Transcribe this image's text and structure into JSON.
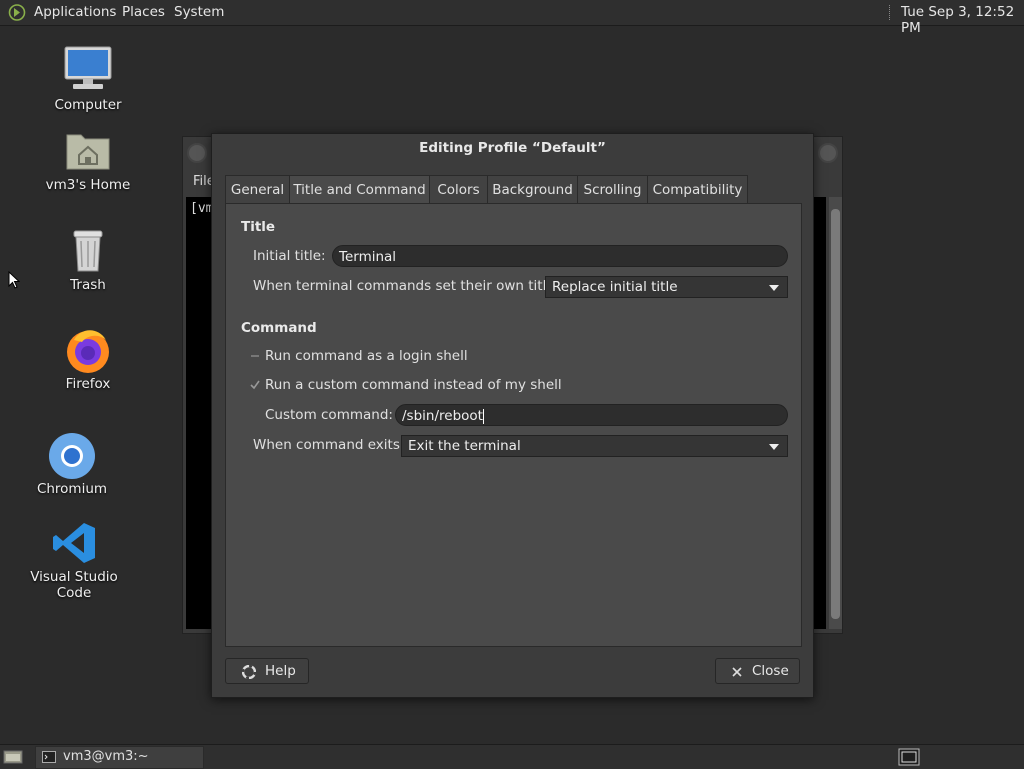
{
  "top_panel": {
    "menus": [
      "Applications",
      "Places",
      "System"
    ],
    "clock": "Tue Sep  3, 12:52 PM"
  },
  "desktop_icons": [
    {
      "label": "Computer",
      "icon": "computer-icon"
    },
    {
      "label": "vm3's Home",
      "icon": "home-folder-icon"
    },
    {
      "label": "Trash",
      "icon": "trash-icon"
    },
    {
      "label": "Firefox",
      "icon": "firefox-icon"
    },
    {
      "label": "Chromium",
      "icon": "chromium-icon"
    },
    {
      "label": "Visual Studio Code",
      "icon": "vscode-icon"
    }
  ],
  "terminal_window": {
    "menu_partial": "File",
    "prompt_partial": "[vm"
  },
  "dialog": {
    "title": "Editing Profile “Default”",
    "tabs": [
      "General",
      "Title and Command",
      "Colors",
      "Background",
      "Scrolling",
      "Compatibility"
    ],
    "active_tab": "Title and Command",
    "title_section": {
      "heading": "Title",
      "initial_title_label": "Initial title:",
      "initial_title_value": "Terminal",
      "own_titles_label": "When terminal commands set their own titles:",
      "own_titles_value": "Replace initial title"
    },
    "command_section": {
      "heading": "Command",
      "login_shell_label": "Run command as a login shell",
      "login_shell_checked": false,
      "custom_command_toggle_label": "Run a custom command instead of my shell",
      "custom_command_toggle_checked": true,
      "custom_command_label": "Custom command:",
      "custom_command_value": "/sbin/reboot",
      "exit_label": "When command exits:",
      "exit_value": "Exit the terminal"
    },
    "help_label": "Help",
    "close_label": "Close"
  },
  "bottom_panel": {
    "task_label": "vm3@vm3:~"
  },
  "colors": {
    "desktop_bg": "#2b2b2b",
    "panel_bg": "#2f2f2f",
    "dialog_bg": "#3c3c3c",
    "tab_body_bg": "#4a4a4a"
  }
}
